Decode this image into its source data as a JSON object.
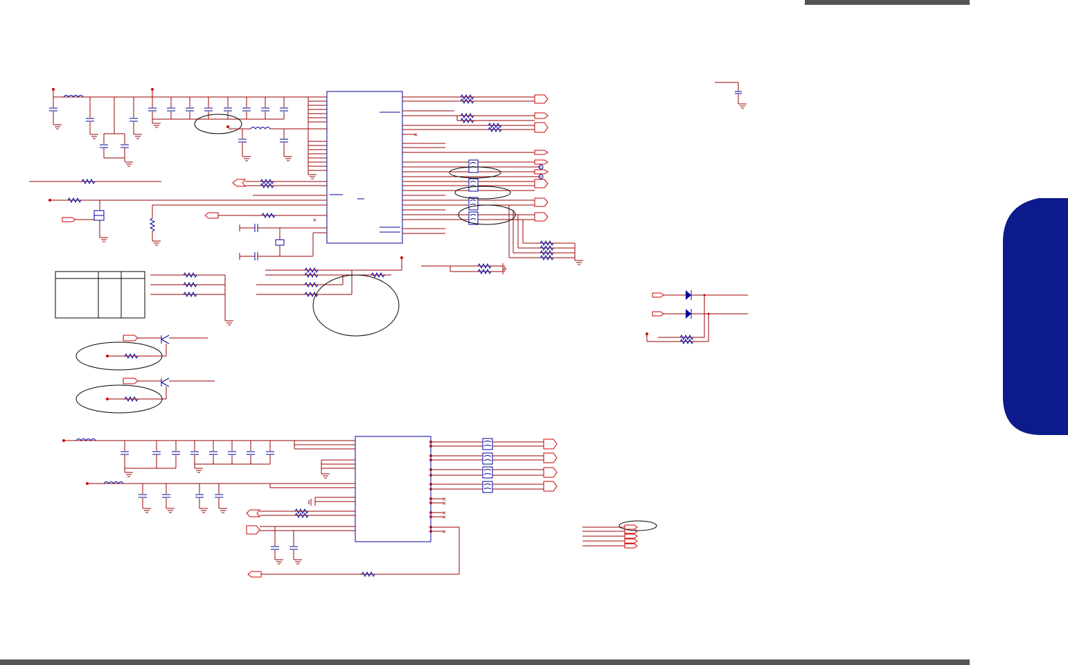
{
  "page": {
    "header_bar_color": "#555555",
    "footer_bar_color": "#555555",
    "side_tab_color": "#0d1a8c",
    "wire_color": "#990000",
    "component_color": "#000099",
    "outline_color": "#000000"
  },
  "schematic": {
    "icons": [
      "resistor-icon",
      "capacitor-icon",
      "inductor-icon",
      "ground-icon",
      "mosfet-icon",
      "transistor-icon",
      "diode-icon",
      "crystal-icon",
      "ferrite-bead-icon",
      "net-port-icon"
    ]
  }
}
